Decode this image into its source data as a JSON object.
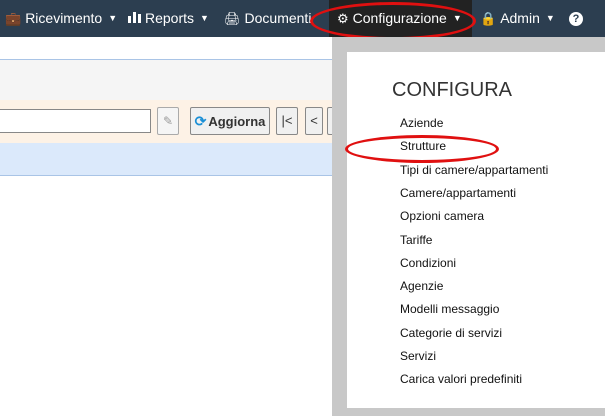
{
  "navbar": {
    "items": [
      {
        "label": "Ricevimento",
        "icon": "suitcase-icon"
      },
      {
        "label": "Reports",
        "icon": "bar-chart-icon"
      },
      {
        "label": "Documenti",
        "icon": "print-icon"
      },
      {
        "label": "Configurazione",
        "icon": "gear-icon"
      },
      {
        "label": "Admin",
        "icon": "lock-icon"
      },
      {
        "label": "",
        "icon": "help-icon"
      }
    ],
    "active": "Configurazione"
  },
  "toolbar": {
    "search_value": "",
    "refresh_label": "Aggiorna",
    "pager": [
      "|<",
      "<",
      ">"
    ]
  },
  "dropdown": {
    "header": "CONFIGURA",
    "items": [
      "Aziende",
      "Strutture",
      "Tipi di camere/appartamenti",
      "Camere/appartamenti",
      "Opzioni camera",
      "Tariffe",
      "Condizioni",
      "Agenzie",
      "Modelli messaggio",
      "Categorie di servizi",
      "Servizi",
      "Carica valori predefiniti"
    ],
    "highlighted": "Strutture"
  },
  "colors": {
    "navbar": "#2c3e50",
    "annotation": "#e01010",
    "refresh_icon": "#1a8fd6"
  }
}
